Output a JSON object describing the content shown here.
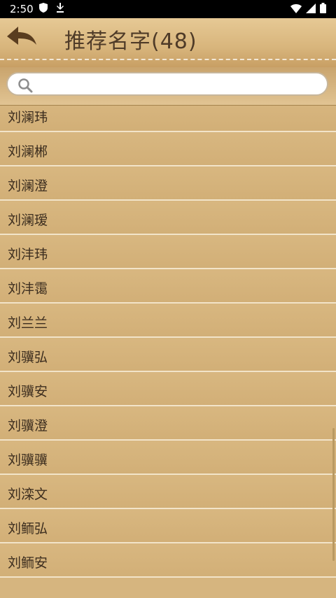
{
  "status_bar": {
    "time": "2:50"
  },
  "header": {
    "title": "推荐名字(48)"
  },
  "search": {
    "value": ""
  },
  "names": [
    "刘澜玮",
    "刘澜郴",
    "刘澜澄",
    "刘澜瑷",
    "刘沣玮",
    "刘沣霭",
    "刘兰兰",
    "刘骥弘",
    "刘骥安",
    "刘骥澄",
    "刘骥骥",
    "刘滦文",
    "刘鲕弘",
    "刘鲕安"
  ]
}
